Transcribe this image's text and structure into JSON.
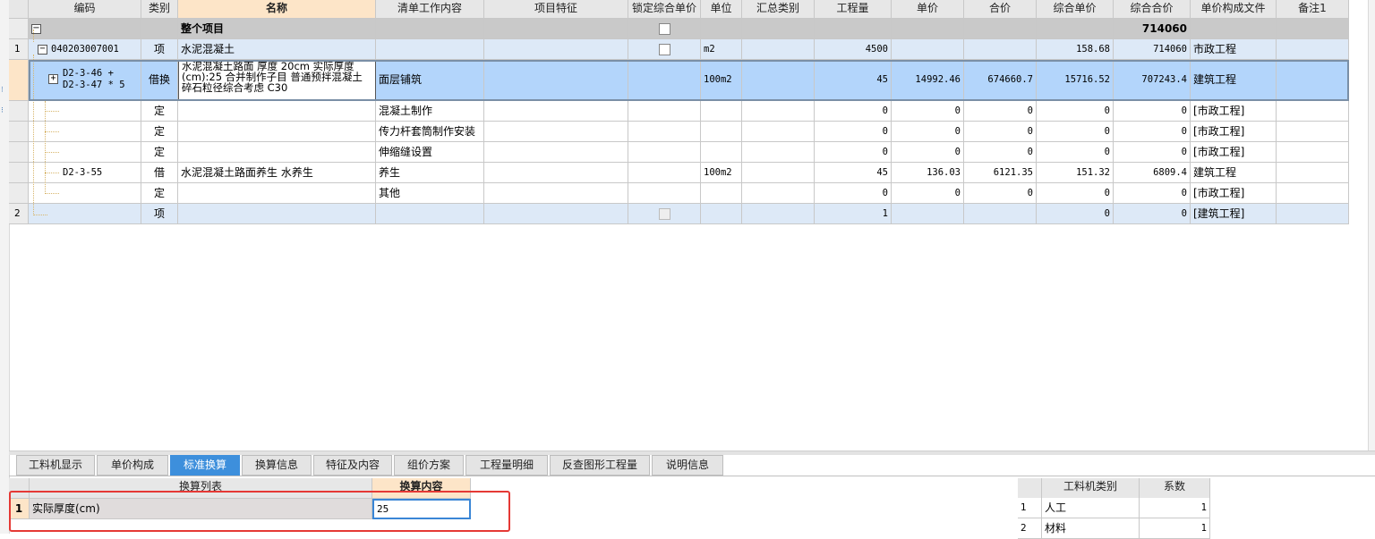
{
  "columns": [
    "",
    "编码",
    "类别",
    "名称",
    "清单工作内容",
    "项目特征",
    "锁定综合单价",
    "单位",
    "汇总类别",
    "工程量",
    "单价",
    "合价",
    "综合单价",
    "综合合价",
    "单价构成文件",
    "备注1"
  ],
  "total_row": {
    "tree": "−",
    "name": "整个项目",
    "total_price": "714060"
  },
  "item1": {
    "num": "1",
    "tree": "−",
    "code": "040203007001",
    "type": "项",
    "name": "水泥混凝土",
    "unit": "m2",
    "qty": "4500",
    "comp_unit": "158.68",
    "comp_total": "714060",
    "file": "市政工程"
  },
  "sel": {
    "tree": "+",
    "code_line1": "D2-3-46 +",
    "code_line2": "D2-3-47 * 5",
    "type": "借换",
    "name": "水泥混凝土路面 厚度 20cm  实际厚度(cm):25  合并制作子目 普通预拌混凝土 碎石粒径综合考虑 C30",
    "work": "面层铺筑",
    "unit": "100m2",
    "qty": "45",
    "price": "14992.46",
    "total": "674660.7",
    "comp_unit": "15716.52",
    "comp_total": "707243.4",
    "file": "建筑工程"
  },
  "subs": [
    {
      "code": "",
      "type": "定",
      "name": "",
      "work": "混凝土制作",
      "unit": "",
      "qty": "0",
      "price": "0",
      "total": "0",
      "comp_unit": "0",
      "comp_total": "0",
      "file": "[市政工程]"
    },
    {
      "code": "",
      "type": "定",
      "name": "",
      "work": "传力杆套筒制作安装",
      "unit": "",
      "qty": "0",
      "price": "0",
      "total": "0",
      "comp_unit": "0",
      "comp_total": "0",
      "file": "[市政工程]"
    },
    {
      "code": "",
      "type": "定",
      "name": "",
      "work": "伸缩缝设置",
      "unit": "",
      "qty": "0",
      "price": "0",
      "total": "0",
      "comp_unit": "0",
      "comp_total": "0",
      "file": "[市政工程]"
    },
    {
      "code": "D2-3-55",
      "type": "借",
      "name": "水泥混凝土路面养生 水养生",
      "work": "养生",
      "unit": "100m2",
      "qty": "45",
      "price": "136.03",
      "total": "6121.35",
      "comp_unit": "151.32",
      "comp_total": "6809.4",
      "file": "建筑工程"
    },
    {
      "code": "",
      "type": "定",
      "name": "",
      "work": "其他",
      "unit": "",
      "qty": "0",
      "price": "0",
      "total": "0",
      "comp_unit": "0",
      "comp_total": "0",
      "file": "[市政工程]"
    }
  ],
  "item2": {
    "num": "2",
    "type": "项",
    "qty": "1",
    "comp_unit": "0",
    "comp_total": "0",
    "file": "[建筑工程]"
  },
  "tabs": [
    "工料机显示",
    "单价构成",
    "标准换算",
    "换算信息",
    "特征及内容",
    "组价方案",
    "工程量明细",
    "反查图形工程量",
    "说明信息"
  ],
  "active_tab": "标准换算",
  "calc": {
    "col_list": "换算列表",
    "col_content": "换算内容",
    "row_num": "1",
    "row_label": "实际厚度(cm)",
    "row_value": "25"
  },
  "labor": {
    "col_type": "工料机类别",
    "col_coef": "系数",
    "rows": [
      {
        "num": "1",
        "type": "人工",
        "coef": "1"
      },
      {
        "num": "2",
        "type": "材料",
        "coef": "1"
      }
    ]
  },
  "colors": {
    "selected_row": "#b3d5fb",
    "item_row": "#dde9f7",
    "total_row": "#c9c9c9",
    "active_tab": "#3d8fdc",
    "highlight_border": "#e53935"
  }
}
